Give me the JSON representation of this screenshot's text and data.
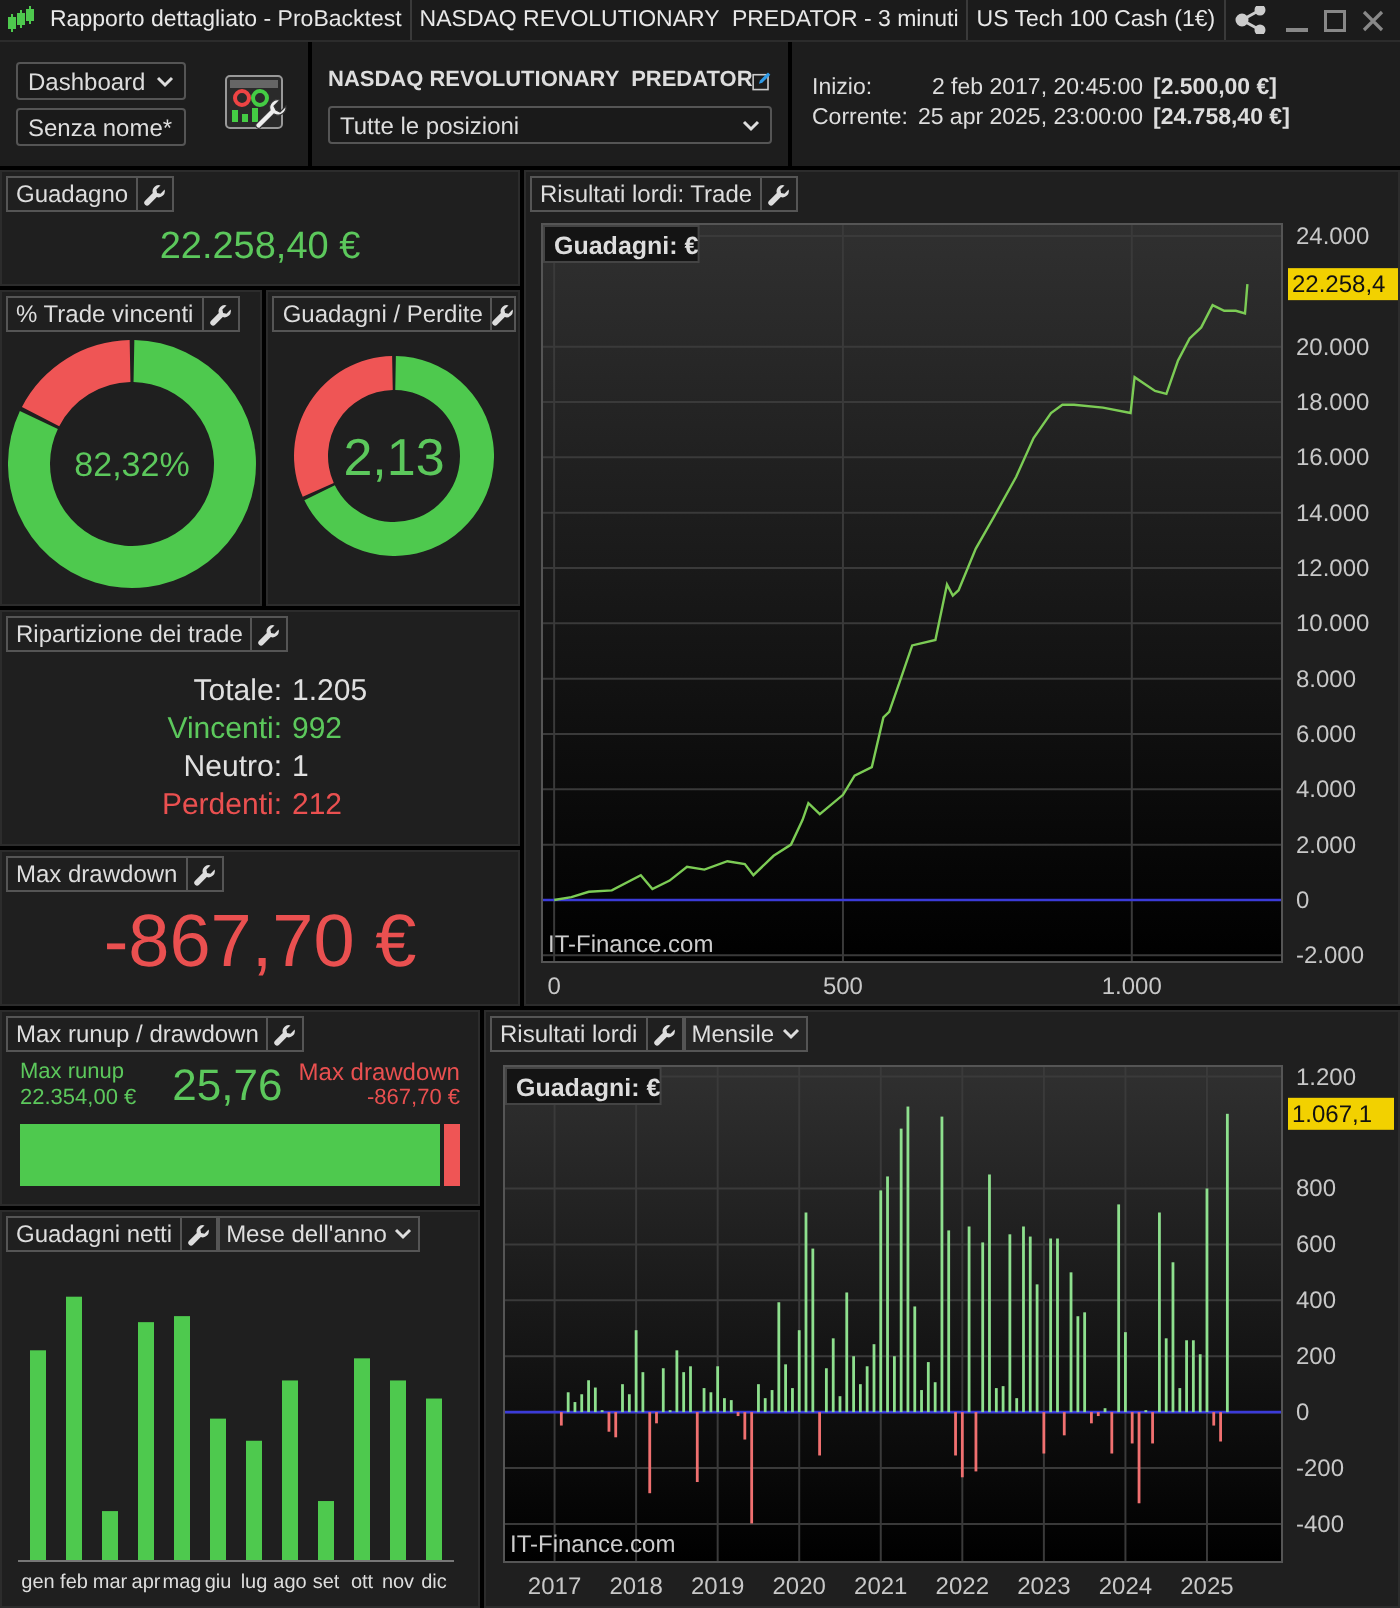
{
  "title_bar": {
    "segments": [
      "Rapporto dettagliato - ProBacktest",
      "NASDAQ REVOLUTIONARY  PREDATOR - 3 minuti",
      "US Tech 100 Cash (1€)"
    ]
  },
  "toolbar": {
    "layout_dropdowns": [
      "Dashboard",
      "Senza nome*"
    ],
    "strategy_name": "NASDAQ REVOLUTIONARY  PREDATOR",
    "positions_dropdown": "Tutte le posizioni",
    "info": [
      {
        "label": "Inizio:",
        "date": "2 feb 2017, 20:45:00",
        "value": "[2.500,00 €]"
      },
      {
        "label": "Corrente:",
        "date": "25 apr 2025, 23:00:00",
        "value": "[24.758,40 €]"
      }
    ]
  },
  "gain": {
    "title": "Guadagno",
    "value": "22.258,40 €"
  },
  "win_rate": {
    "title": "% Trade vincenti",
    "value": "82,32%",
    "chart_data": {
      "type": "donut",
      "values": [
        82.32,
        17.68
      ]
    }
  },
  "profit_factor": {
    "title": "Guadagni / Perdite",
    "value": "2,13",
    "chart_data": {
      "type": "donut",
      "values": [
        68,
        32
      ]
    }
  },
  "breakdown": {
    "title": "Ripartizione dei trade",
    "rows": [
      {
        "kind": "total",
        "label": "Totale:",
        "value": "1.205"
      },
      {
        "kind": "win",
        "label": "Vincenti:",
        "value": "992"
      },
      {
        "kind": "neutral",
        "label": "Neutro:",
        "value": "1"
      },
      {
        "kind": "loss",
        "label": "Perdenti:",
        "value": "212"
      }
    ]
  },
  "max_drawdown": {
    "title": "Max drawdown",
    "value": "-867,70 €"
  },
  "trade_chart": {
    "title": "Risultati lordi: Trade",
    "credit": "IT-Finance.com",
    "chart_data": {
      "type": "line",
      "grid": true,
      "x": [
        0,
        30,
        60,
        100,
        150,
        170,
        200,
        230,
        260,
        300,
        330,
        345,
        380,
        410,
        430,
        440,
        460,
        500,
        520,
        550,
        570,
        580,
        600,
        620,
        660,
        680,
        690,
        700,
        730,
        760,
        800,
        830,
        860,
        880,
        900,
        950,
        998,
        1005,
        1040,
        1060,
        1080,
        1100,
        1120,
        1140,
        1160,
        1180,
        1196,
        1200
      ],
      "series": [
        {
          "name": "Guadagni: €",
          "color": "#7ccc55",
          "values": [
            0,
            100,
            300,
            350,
            900,
            400,
            700,
            1200,
            1100,
            1400,
            1300,
            900,
            1600,
            2000,
            2900,
            3500,
            3100,
            3800,
            4500,
            4800,
            6600,
            6800,
            8000,
            9200,
            9400,
            11400,
            11000,
            11200,
            12700,
            13800,
            15300,
            16700,
            17600,
            17900,
            17900,
            17800,
            17600,
            18900,
            18400,
            18300,
            19500,
            20300,
            20700,
            21500,
            21300,
            21300,
            21200,
            22260
          ]
        }
      ],
      "xlim": [
        -21,
        1260
      ],
      "ylim": [
        -2240,
        24434
      ],
      "xticks": [
        0,
        500,
        {
          "value": 1000,
          "label": "1.000"
        }
      ],
      "yticks": [
        {
          "value": 24000,
          "label": "24.000"
        },
        {
          "value": 20000,
          "label": "20.000"
        },
        {
          "value": 18000,
          "label": "18.000"
        },
        {
          "value": 16000,
          "label": "16.000"
        },
        {
          "value": 14000,
          "label": "14.000"
        },
        {
          "value": 12000,
          "label": "12.000"
        },
        {
          "value": 10000,
          "label": "10.000"
        },
        {
          "value": 8000,
          "label": "8.000"
        },
        {
          "value": 6000,
          "label": "6.000"
        },
        {
          "value": 4000,
          "label": "4.000"
        },
        {
          "value": 2000,
          "label": "2.000"
        },
        0,
        {
          "value": -2000,
          "label": "-2.000"
        }
      ],
      "ref_lines": [
        {
          "axis": "y",
          "value": 0,
          "color": "#3b3bd8"
        }
      ],
      "annotations": [
        {
          "text": "22.258,4"
        }
      ]
    }
  },
  "runup": {
    "title": "Max runup / drawdown",
    "runup_label": "Max runup",
    "runup_value": "22.354,00 €",
    "ratio": "25,76",
    "drawdown_label": "Max drawdown",
    "drawdown_value": "-867,70 €",
    "level": 0.9626
  },
  "monthly_net": {
    "title": "Guadagni netti",
    "dropdown": "Mese dell'anno",
    "months": [
      "gen",
      "feb",
      "mar",
      "apr",
      "mag",
      "giu",
      "lug",
      "ago",
      "set",
      "ott",
      "nov",
      "dic"
    ]
  },
  "monthly_chart": {
    "title": "Risultati lordi",
    "dropdown": "Mensile",
    "credit": "IT-Finance.com",
    "chart_data": {
      "type": "bar",
      "grid": true,
      "x": [
        2017.083,
        2017.167,
        2017.25,
        2017.333,
        2017.417,
        2017.5,
        2017.583,
        2017.667,
        2017.75,
        2017.833,
        2017.917,
        2018,
        2018.083,
        2018.167,
        2018.25,
        2018.333,
        2018.417,
        2018.5,
        2018.583,
        2018.667,
        2018.75,
        2018.833,
        2018.917,
        2019,
        2019.083,
        2019.167,
        2019.25,
        2019.333,
        2019.417,
        2019.5,
        2019.583,
        2019.667,
        2019.75,
        2019.833,
        2019.917,
        2020,
        2020.083,
        2020.167,
        2020.25,
        2020.333,
        2020.417,
        2020.5,
        2020.583,
        2020.667,
        2020.75,
        2020.833,
        2020.917,
        2021,
        2021.083,
        2021.167,
        2021.25,
        2021.333,
        2021.417,
        2021.5,
        2021.583,
        2021.667,
        2021.75,
        2021.833,
        2021.917,
        2022,
        2022.083,
        2022.167,
        2022.25,
        2022.333,
        2022.417,
        2022.5,
        2022.583,
        2022.667,
        2022.75,
        2022.833,
        2022.917,
        2023,
        2023.083,
        2023.167,
        2023.25,
        2023.333,
        2023.417,
        2023.5,
        2023.583,
        2023.667,
        2023.75,
        2023.833,
        2023.917,
        2024,
        2024.083,
        2024.167,
        2024.25,
        2024.333,
        2024.417,
        2024.5,
        2024.583,
        2024.667,
        2024.75,
        2024.833,
        2024.917,
        2025,
        2025.083,
        2025.167,
        2025.25
      ],
      "series": [
        {
          "name": "Guadagni: €",
          "color": "#8ee08e",
          "values": [
            null,
            71,
            36,
            64,
            114,
            88,
            7,
            null,
            null,
            100,
            64,
            293,
            143,
            null,
            null,
            157,
            7,
            221,
            143,
            164,
            null,
            86,
            71,
            164,
            50,
            43,
            null,
            null,
            null,
            100,
            50,
            79,
            393,
            171,
            86,
            293,
            714,
            585,
            null,
            157,
            264,
            57,
            428,
            200,
            100,
            164,
            243,
            793,
            843,
            200,
            1014,
            1093,
            378,
            79,
            179,
            107,
            1057,
            650,
            null,
            null,
            664,
            null,
            607,
            850,
            86,
            93,
            636,
            50,
            664,
            628,
            457,
            null,
            621,
            621,
            null,
            500,
            343,
            357,
            null,
            null,
            14,
            null,
            743,
            286,
            null,
            null,
            7,
            null,
            714,
            264,
            536,
            86,
            257,
            257,
            207,
            800,
            null,
            null,
            1067
          ]
        },
        {
          "color": "#f07070",
          "values": [
            -48,
            null,
            null,
            null,
            null,
            null,
            null,
            -70,
            -90,
            null,
            null,
            null,
            null,
            -290,
            -40,
            null,
            null,
            null,
            null,
            null,
            -250,
            null,
            null,
            null,
            null,
            null,
            -14,
            -98,
            -398,
            null,
            null,
            null,
            null,
            null,
            null,
            null,
            null,
            null,
            -155,
            null,
            null,
            null,
            null,
            null,
            null,
            null,
            null,
            null,
            null,
            null,
            null,
            null,
            null,
            null,
            null,
            null,
            null,
            null,
            -155,
            -233,
            null,
            -212,
            null,
            null,
            null,
            null,
            null,
            null,
            null,
            null,
            null,
            -148,
            null,
            null,
            -83,
            null,
            null,
            null,
            -40,
            -14,
            null,
            -148,
            null,
            null,
            -112,
            -326,
            null,
            -112,
            null,
            null,
            null,
            null,
            null,
            null,
            null,
            null,
            -48,
            -105,
            null
          ]
        }
      ],
      "xlim": [
        2016.38,
        2025.92
      ],
      "ylim": [
        -536,
        1238
      ],
      "xticks": [
        2017,
        2018,
        2019,
        2020,
        2021,
        2022,
        2023,
        2024,
        2025
      ],
      "yticks": [
        {
          "value": 1200,
          "label": "1.200"
        },
        800,
        600,
        400,
        200,
        0,
        -200,
        -400
      ],
      "ref_lines": [
        {
          "axis": "y",
          "value": 0,
          "color": "#3b3bd8"
        }
      ],
      "annotations": [
        {
          "text": "1.067,1"
        }
      ]
    }
  }
}
